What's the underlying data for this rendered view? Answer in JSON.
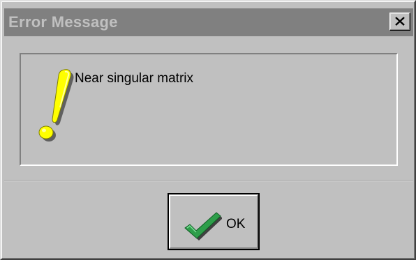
{
  "dialog": {
    "title": "Error Message",
    "message": "Near singular matrix",
    "icon": "exclamation-icon",
    "close_icon": "close-icon"
  },
  "buttons": {
    "ok_label": "OK",
    "ok_icon": "checkmark-icon"
  },
  "colors": {
    "face": "#c0c0c0",
    "titlebar": "#808080",
    "title_text": "#c0c0c0",
    "icon_yellow": "#ffff00",
    "check_green": "#2e9e4a"
  }
}
